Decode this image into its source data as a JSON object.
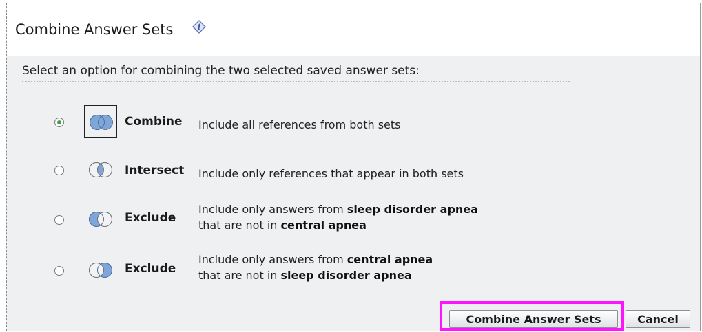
{
  "dialog": {
    "title": "Combine Answer Sets",
    "prompt": "Select an option for combining the two selected saved answer sets:"
  },
  "options": [
    {
      "label": "Combine",
      "selected": true,
      "desc_line1_pre": "Include all references from both sets",
      "desc_line1_bold": "",
      "desc_line2_pre": "",
      "desc_line2_bold": "",
      "icon": "venn-union-icon"
    },
    {
      "label": "Intersect",
      "selected": false,
      "desc_line1_pre": "Include only references that appear in both sets",
      "desc_line1_bold": "",
      "desc_line2_pre": "",
      "desc_line2_bold": "",
      "icon": "venn-intersection-icon"
    },
    {
      "label": "Exclude",
      "selected": false,
      "desc_line1_pre": "Include only answers from ",
      "desc_line1_bold": "sleep disorder apnea",
      "desc_line2_pre": "that are not in ",
      "desc_line2_bold": "central apnea",
      "icon": "venn-exclude-left-icon"
    },
    {
      "label": "Exclude",
      "selected": false,
      "desc_line1_pre": "Include only answers from ",
      "desc_line1_bold": "central apnea",
      "desc_line2_pre": "that are not in ",
      "desc_line2_bold": "sleep disorder apnea",
      "icon": "venn-exclude-right-icon"
    }
  ],
  "buttons": {
    "combine_label": "Combine Answer Sets",
    "cancel_label": "Cancel"
  },
  "colors": {
    "highlight": "#ff14ff",
    "radio_selected": "#3aa14a",
    "venn_fill": "#7fa6d8"
  }
}
